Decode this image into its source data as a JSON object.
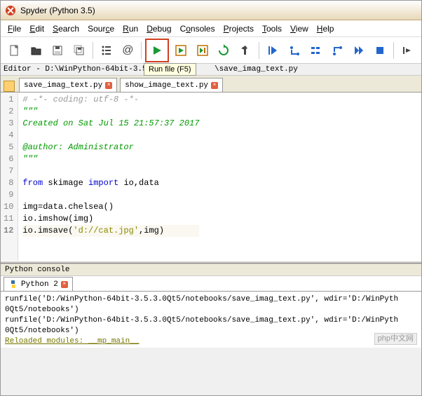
{
  "window": {
    "title": "Spyder (Python 3.5)"
  },
  "menu": {
    "items": [
      "File",
      "Edit",
      "Search",
      "Source",
      "Run",
      "Debug",
      "Consoles",
      "Projects",
      "Tools",
      "View",
      "Help"
    ]
  },
  "toolbar": {
    "tooltip": "Run file (F5)",
    "icons": [
      "new",
      "open",
      "save",
      "save-all",
      "sep",
      "outline",
      "at",
      "sep",
      "run",
      "run-cell",
      "run-cell-adv",
      "rerun",
      "run-config",
      "sep",
      "debug-start",
      "debug-step-in",
      "debug-step-over",
      "debug-step-out",
      "debug-continue",
      "debug-stop",
      "sep",
      "more"
    ]
  },
  "editor": {
    "path_prefix": "Editor - D:\\WinPython-64bit-3.5.3.0",
    "path_suffix": "\\save_imag_text.py",
    "tabs": [
      {
        "label": "save_imag_text.py",
        "active": true
      },
      {
        "label": "show_image_text.py",
        "active": false
      }
    ]
  },
  "code": {
    "lines": [
      {
        "n": 1,
        "text": "# -*- coding: utf-8 -*-",
        "style": "gray"
      },
      {
        "n": 2,
        "text": "\"\"\"",
        "style": "green"
      },
      {
        "n": 3,
        "text": "Created on Sat Jul 15 21:57:37 2017",
        "style": "green"
      },
      {
        "n": 4,
        "text": "",
        "style": ""
      },
      {
        "n": 5,
        "text": "@author: Administrator",
        "style": "green"
      },
      {
        "n": 6,
        "text": "\"\"\"",
        "style": "green"
      },
      {
        "n": 7,
        "text": "",
        "style": ""
      },
      {
        "n": 8,
        "segments": [
          {
            "t": "from ",
            "c": "blue"
          },
          {
            "t": "skimage ",
            "c": ""
          },
          {
            "t": "import ",
            "c": "blue"
          },
          {
            "t": "io,data",
            "c": ""
          }
        ]
      },
      {
        "n": 9,
        "text": "",
        "style": ""
      },
      {
        "n": 10,
        "text": "img=data.chelsea()",
        "style": ""
      },
      {
        "n": 11,
        "text": "io.imshow(img)",
        "style": ""
      },
      {
        "n": 12,
        "current": true,
        "segments": [
          {
            "t": "io.imsave(",
            "c": ""
          },
          {
            "t": "'d://cat.jpg'",
            "c": "olive"
          },
          {
            "t": ",img)",
            "c": ""
          }
        ]
      }
    ]
  },
  "console": {
    "label": "Python console",
    "tab": "Python 2",
    "lines": [
      "runfile('D:/WinPython-64bit-3.5.3.0Qt5/notebooks/save_imag_text.py', wdir='D:/WinPyth",
      "0Qt5/notebooks')",
      "runfile('D:/WinPython-64bit-3.5.3.0Qt5/notebooks/save_imag_text.py', wdir='D:/WinPyth",
      "0Qt5/notebooks')"
    ],
    "reloaded": "Reloaded modules: __mp_main__"
  },
  "watermark": "php中文网"
}
